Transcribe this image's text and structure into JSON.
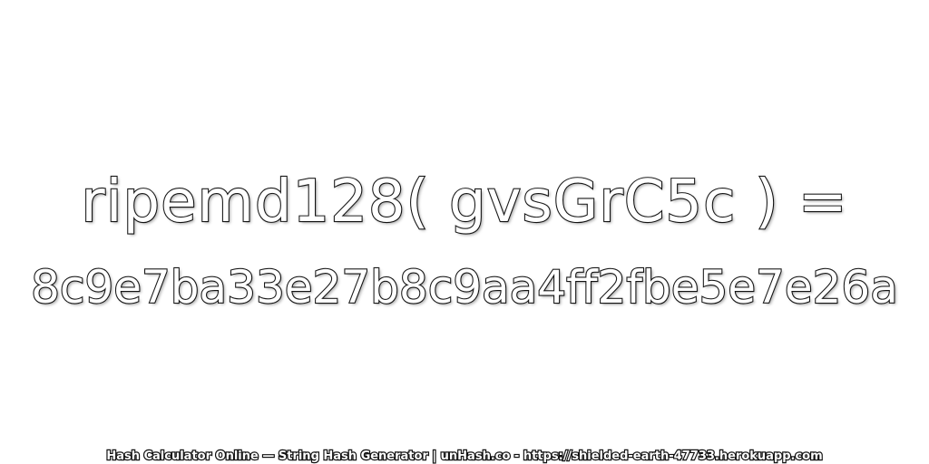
{
  "expression": "ripemd128( gvsGrC5c ) =",
  "hash_value": "8c9e7ba33e27b8c9aa4ff2fbe5e7e26a",
  "footer": "Hash Calculator Online — String Hash Generator | unHash.co - https://shielded-earth-47733.herokuapp.com",
  "colors": {
    "background": "#ffffff",
    "text_fill": "#ffffff",
    "text_outline": "#1a1a1a"
  }
}
